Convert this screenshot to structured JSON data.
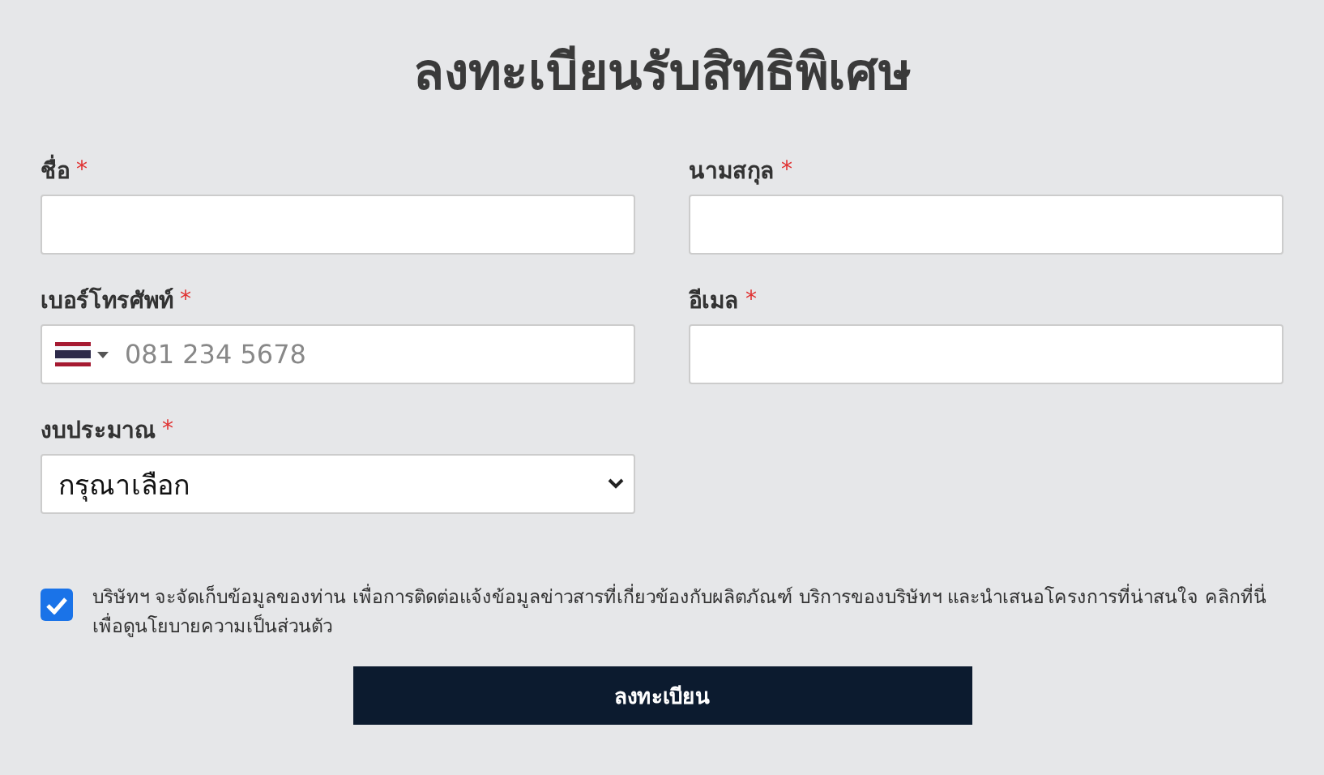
{
  "title": "ลงทะเบียนรับสิทธิพิเศษ",
  "fields": [
    {
      "kind": "text",
      "label": "ชื่อ",
      "required_mark": "*"
    },
    {
      "kind": "text",
      "label": "นามสกุล",
      "required_mark": "*"
    },
    {
      "kind": "phone",
      "label": "เบอร์โทรศัพท์",
      "required_mark": "*",
      "placeholder": "081 234 5678"
    },
    {
      "kind": "text",
      "label": "อีเมล",
      "required_mark": "*"
    },
    {
      "kind": "select",
      "label": "งบประมาณ",
      "required_mark": "*",
      "value": "กรุณาเลือก"
    }
  ],
  "consent": {
    "checked": true,
    "text": "บริษัทฯ จะจัดเก็บข้อมูลของท่าน เพื่อการติดต่อแจ้งข้อมูลข่าวสารที่เกี่ยวข้องกับผลิตภัณฑ์ บริการของบริษัทฯ และนำเสนอโครงการที่น่าสนใจ คลิกที่นี่เพื่อดูนโยบายความเป็นส่วนตัว"
  },
  "submit_button": "ลงทะเบียน"
}
